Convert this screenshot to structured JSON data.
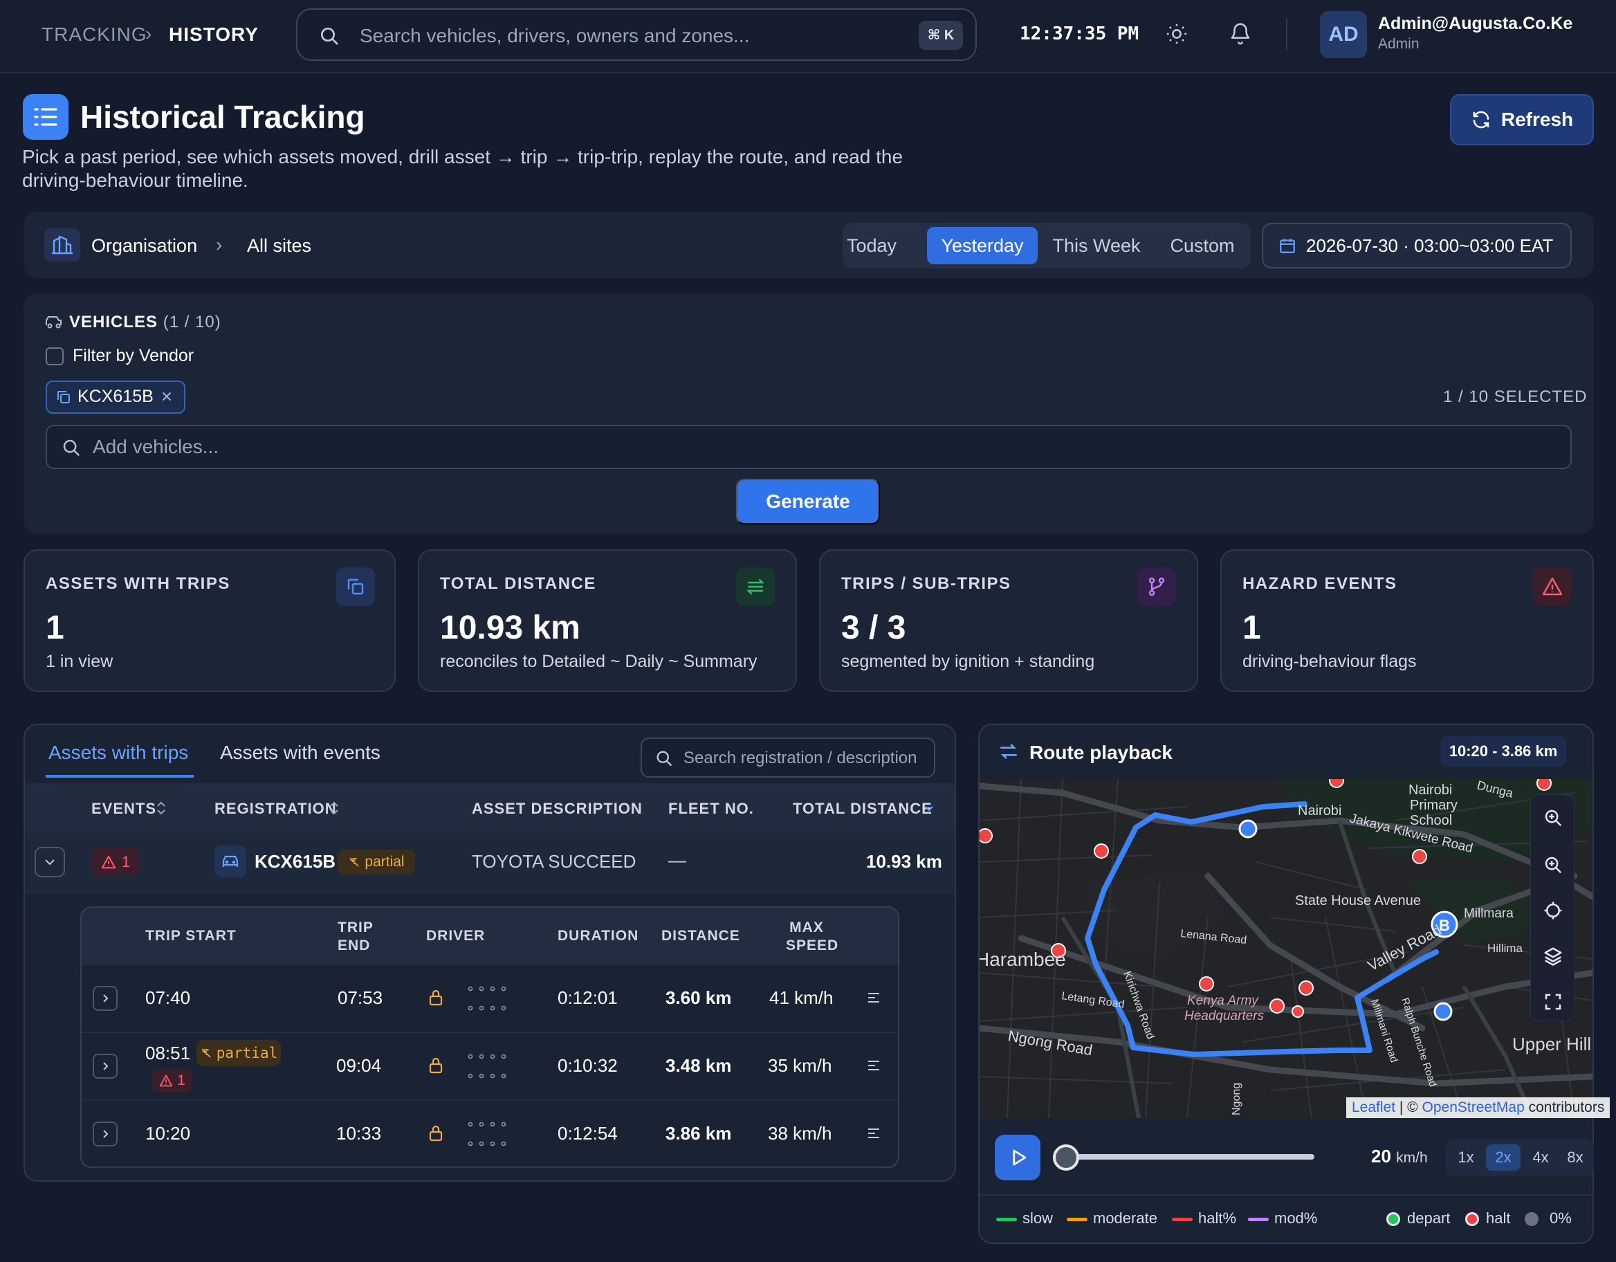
{
  "topbar": {
    "breadcrumb_root": "TRACKING",
    "breadcrumb_current": "HISTORY",
    "search_placeholder": "Search vehicles, drivers, owners and zones...",
    "search_shortcut": "⌘ K",
    "clock": "12:37:35 PM",
    "user_initials": "AD",
    "user_email": "Admin@Augusta.Co.Ke",
    "user_role": "Admin"
  },
  "header": {
    "title": "Historical Tracking",
    "subtitle": "Pick a past period, see which assets moved, drill asset → trip → trip-trip, replay the route, and read the driving-behaviour timeline.",
    "refresh_label": "Refresh"
  },
  "scope": {
    "org_label": "Organisation",
    "site_label": "All sites",
    "periods": [
      "Today",
      "Yesterday",
      "This Week",
      "Custom"
    ],
    "active_period": "Yesterday",
    "date_range": "2026-07-30 · 03:00~03:00 EAT"
  },
  "vehicles": {
    "heading": "VEHICLES",
    "count": "(1 / 10)",
    "filter_vendor_label": "Filter by Vendor",
    "selected_chip": "KCX615B",
    "selected_count": "1 / 10 SELECTED",
    "add_placeholder": "Add vehicles...",
    "generate_label": "Generate"
  },
  "stats": [
    {
      "title": "ASSETS WITH TRIPS",
      "value": "1",
      "sub": "1 in view"
    },
    {
      "title": "TOTAL DISTANCE",
      "value": "10.93 km",
      "sub": "reconciles to Detailed ~ Daily ~ Summary"
    },
    {
      "title": "TRIPS / SUB-TRIPS",
      "value": "3 / 3",
      "sub": "segmented by ignition + standing"
    },
    {
      "title": "HAZARD EVENTS",
      "value": "1",
      "sub": "driving-behaviour flags"
    }
  ],
  "assets": {
    "tabs": [
      "Assets with trips",
      "Assets with events"
    ],
    "search_placeholder": "Search registration / description",
    "columns": [
      "EVENTS",
      "REGISTRATION",
      "ASSET DESCRIPTION",
      "FLEET NO.",
      "TOTAL DISTANCE"
    ],
    "row": {
      "events": "1",
      "registration": "KCX615B",
      "partial_label": "partial",
      "description": "TOYOTA SUCCEED",
      "fleet_no": "—",
      "total_distance": "10.93 km"
    },
    "trip_columns": {
      "start": "TRIP START",
      "end_1": "TRIP",
      "end_2": "END",
      "driver": "DRIVER",
      "duration": "DURATION",
      "distance": "DISTANCE",
      "max_1": "MAX",
      "max_2": "SPEED"
    },
    "trips": [
      {
        "start": "07:40",
        "end": "07:53",
        "duration": "0:12:01",
        "distance": "3.60 km",
        "max_speed": "41 km/h"
      },
      {
        "start": "08:51",
        "partial": "partial",
        "events": "1",
        "end": "09:04",
        "duration": "0:10:32",
        "distance": "3.48 km",
        "max_speed": "35 km/h"
      },
      {
        "start": "10:20",
        "end": "10:33",
        "duration": "0:12:54",
        "distance": "3.86 km",
        "max_speed": "38 km/h"
      }
    ]
  },
  "playback": {
    "title": "Route playback",
    "badge": "10:20 - 3.86 km",
    "speed_value": "20",
    "speed_unit": "km/h",
    "rates": [
      "1x",
      "2x",
      "4x",
      "8x"
    ],
    "active_rate": "2x",
    "progress": 0.0,
    "attribution_leaflet": "Leaflet",
    "attribution_mid": " | © ",
    "attribution_osm": "OpenStreetMap",
    "attribution_end": " contributors",
    "map_labels": {
      "nairobi": "Nairobi",
      "school_1": "Nairobi",
      "school_2": "Primary",
      "school_3": "School",
      "jakaya": "Jakaya Kikwete Road",
      "state_house": "State House Avenue",
      "millmara": "Millmara",
      "hillima": "Hillima",
      "lenana": "Lenana Road",
      "valley": "Valley Road",
      "harambee": "Harambee",
      "letang": "Letang Road",
      "kirichwa": "Kirichwa Road",
      "army_1": "Kenya Army",
      "army_2": "Headquarters",
      "ngong": "Ngong Road",
      "upper": "Upper Hill",
      "ngong_v": "Ngong",
      "milimani": "Milimani Road",
      "ralph": "Ralph Bunche Road",
      "dunga": "Dunga"
    },
    "legend": {
      "slow": "slow",
      "moderate": "moderate",
      "halt": "halt%",
      "mod": "mod%",
      "depart": "depart",
      "halt_pt": "halt",
      "zero": "0%"
    }
  },
  "colors": {
    "accent": "#3b82f6",
    "slow": "#22c55e",
    "moderate": "#f59e0b",
    "halt": "#ef4444",
    "mod": "#c084fc",
    "warning": "#f2a93b",
    "danger": "#ff5b6b"
  }
}
